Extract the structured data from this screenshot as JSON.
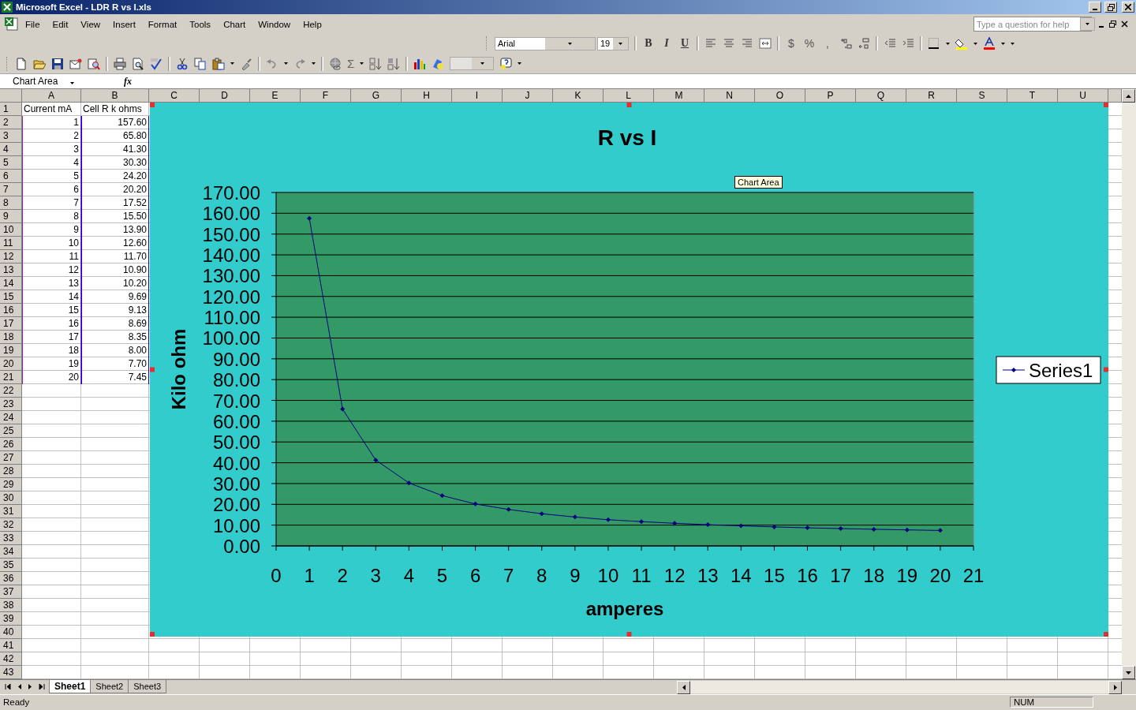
{
  "window": {
    "title": "Microsoft Excel - LDR R vs I.xls"
  },
  "menu": [
    "File",
    "Edit",
    "View",
    "Insert",
    "Format",
    "Tools",
    "Chart",
    "Window",
    "Help"
  ],
  "help_box": {
    "placeholder": "Type a question for help"
  },
  "formatting_toolbar": {
    "font": "Arial",
    "size": "19",
    "styles": [
      "B",
      "I",
      "U"
    ],
    "number_formats": [
      "$",
      "%",
      ","
    ]
  },
  "standard_toolbar": {
    "autosum": "Σ"
  },
  "formula_bar": {
    "name_box": "Chart Area",
    "function_label": "fx"
  },
  "sheet": {
    "columns": [
      "A",
      "B",
      "C",
      "D",
      "E",
      "F",
      "G",
      "H",
      "I",
      "J",
      "K",
      "L",
      "M",
      "N",
      "O",
      "P",
      "Q",
      "R",
      "S",
      "T",
      "U"
    ],
    "row_numbers": [
      "1",
      "2",
      "3",
      "4",
      "5",
      "6",
      "7",
      "8",
      "9",
      "10",
      "11",
      "12",
      "13",
      "14",
      "15",
      "16",
      "17",
      "18",
      "19",
      "20",
      "21",
      "22",
      "23",
      "24",
      "25",
      "26",
      "27",
      "28",
      "29",
      "30",
      "31",
      "32",
      "33",
      "34",
      "35",
      "36",
      "37",
      "38",
      "39",
      "40",
      "41",
      "42",
      "43"
    ],
    "rows": [
      [
        "Current mA",
        "Cell R k ohms"
      ],
      [
        "1",
        "157.60"
      ],
      [
        "2",
        "65.80"
      ],
      [
        "3",
        "41.30"
      ],
      [
        "4",
        "30.30"
      ],
      [
        "5",
        "24.20"
      ],
      [
        "6",
        "20.20"
      ],
      [
        "7",
        "17.52"
      ],
      [
        "8",
        "15.50"
      ],
      [
        "9",
        "13.90"
      ],
      [
        "10",
        "12.60"
      ],
      [
        "11",
        "11.70"
      ],
      [
        "12",
        "10.90"
      ],
      [
        "13",
        "10.20"
      ],
      [
        "14",
        "9.69"
      ],
      [
        "15",
        "9.13"
      ],
      [
        "16",
        "8.69"
      ],
      [
        "17",
        "8.35"
      ],
      [
        "18",
        "8.00"
      ],
      [
        "19",
        "7.70"
      ],
      [
        "20",
        "7.45"
      ]
    ]
  },
  "chart": {
    "tooltip": "Chart Area",
    "chart_data": {
      "type": "line",
      "title": "R vs I",
      "xlabel": "amperes",
      "ylabel": "Kilo ohm",
      "x": [
        1,
        2,
        3,
        4,
        5,
        6,
        7,
        8,
        9,
        10,
        11,
        12,
        13,
        14,
        15,
        16,
        17,
        18,
        19,
        20
      ],
      "series": [
        {
          "name": "Series1",
          "color": "#000080",
          "values": [
            157.6,
            65.8,
            41.3,
            30.3,
            24.2,
            20.2,
            17.52,
            15.5,
            13.9,
            12.6,
            11.7,
            10.9,
            10.2,
            9.69,
            9.13,
            8.69,
            8.35,
            8.0,
            7.7,
            7.45
          ]
        }
      ],
      "xlim": [
        0,
        21
      ],
      "ylim": [
        0,
        170
      ],
      "grid": true,
      "marker": true,
      "xticks": [
        0,
        1,
        2,
        3,
        4,
        5,
        6,
        7,
        8,
        9,
        10,
        11,
        12,
        13,
        14,
        15,
        16,
        17,
        18,
        19,
        20,
        21
      ],
      "yticks": [
        {
          "value": 0,
          "label": "0.00"
        },
        {
          "value": 10,
          "label": "10.00"
        },
        {
          "value": 20,
          "label": "20.00"
        },
        {
          "value": 30,
          "label": "30.00"
        },
        {
          "value": 40,
          "label": "40.00"
        },
        {
          "value": 50,
          "label": "50.00"
        },
        {
          "value": 60,
          "label": "60.00"
        },
        {
          "value": 70,
          "label": "70.00"
        },
        {
          "value": 80,
          "label": "80.00"
        },
        {
          "value": 90,
          "label": "90.00"
        },
        {
          "value": 100,
          "label": "100.00"
        },
        {
          "value": 110,
          "label": "110.00"
        },
        {
          "value": 120,
          "label": "120.00"
        },
        {
          "value": 130,
          "label": "130.00"
        },
        {
          "value": 140,
          "label": "140.00"
        },
        {
          "value": 150,
          "label": "150.00"
        },
        {
          "value": 160,
          "label": "160.00"
        },
        {
          "value": 170,
          "label": "170.00"
        }
      ]
    }
  },
  "sheet_tabs": [
    {
      "label": "Sheet1",
      "selected": true
    },
    {
      "label": "Sheet2",
      "selected": false
    },
    {
      "label": "Sheet3",
      "selected": false
    }
  ],
  "status_bar": {
    "message": "Ready",
    "num_lock": "NUM"
  }
}
